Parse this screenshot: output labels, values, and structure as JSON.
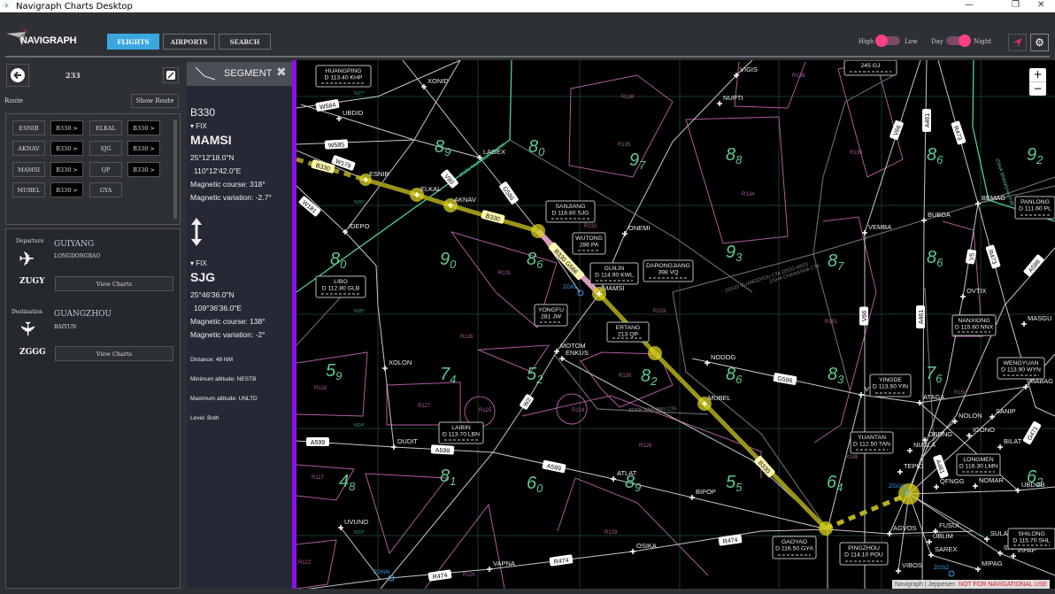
{
  "window": {
    "title": "Navigraph Charts Desktop",
    "controls": [
      "—",
      "❐",
      "✕"
    ]
  },
  "header": {
    "logo_text": "NAVIGRAPH",
    "tabs": [
      "FLIGHTS",
      "AIRPORTS",
      "SEARCH"
    ],
    "active_tab": "FLIGHTS",
    "detail_toggle": {
      "left": "High",
      "right": "Low",
      "value": "High"
    },
    "theme_toggle": {
      "left": "Day",
      "right": "Night",
      "value": "Night"
    },
    "accent": "#3aa7e0",
    "toggle_color": "#ff3f83"
  },
  "flight": {
    "id": "233",
    "route_label": "Route",
    "show_route": "Show Route",
    "route": [
      [
        "ESNIB",
        "B330 >",
        "ELKAL",
        "B330 >"
      ],
      [
        "AKNAV",
        "B330 >",
        "SJG",
        "B330 >"
      ],
      [
        "MAMSI",
        "B330 >",
        "QP",
        "B330 >"
      ],
      [
        "MUBEL",
        "B330 >",
        "GYA",
        ""
      ]
    ],
    "departure": {
      "label": "Departure",
      "city": "GUIYANG",
      "airport": "LONGDONGBAO",
      "icao": "ZUGY",
      "button": "View Charts"
    },
    "destination": {
      "label": "Destination",
      "city": "GUANGZHOU",
      "airport": "BAIYUN",
      "icao": "ZGGG",
      "button": "View Charts"
    }
  },
  "segment": {
    "title": "SEGMENT",
    "airway": "B330",
    "from": {
      "type": "FIX",
      "name": "MAMSI",
      "lat": "25°12'18.0\"N",
      "lon": "110°12'42.0\"E",
      "course": "Magnetic course: 318°",
      "variation": "Magnetic variation: -2.7°"
    },
    "to": {
      "type": "FIX",
      "name": "SJG",
      "lat": "25°46'36.0\"N",
      "lon": "109°36'36.0\"E",
      "course": "Magnetic course: 138°",
      "variation": "Magnetic variation: -2°"
    },
    "distance": "Distance: 48 NM",
    "min_alt": "Minimum altitude: NESTB",
    "max_alt": "Maximum altitude: UNLTD",
    "level": "Level: Both"
  },
  "map": {
    "zoom_in": "+",
    "zoom_out": "−",
    "attribution": {
      "navigraph": "Navigraph",
      "jeppesen": "Jeppesen",
      "warning": "NOT FOR NAVIGATIONAL USE"
    },
    "waypoints": [
      "ESNIB",
      "ELKAL",
      "AKNAV",
      "MAMSI",
      "MUBEL",
      "XONID",
      "UBDID",
      "LAGEX",
      "IDEPO",
      "NUPTI",
      "VIGIS",
      "ONEMI",
      "VEMBA",
      "BUBDA",
      "BEMAG",
      "MOTOM",
      "ENKUS",
      "XOLON",
      "NODOG",
      "VEROK",
      "ATAGA",
      "DUDIT",
      "ATLAT",
      "BIPOP",
      "UVUNO",
      "VAPNA",
      "OSIKA",
      "AGVOS",
      "OVTIX",
      "MASGU",
      "MABAG",
      "NOLON",
      "SANIP",
      "IGONO",
      "BILAT",
      "DBDNG",
      "NUSLA",
      "TEPID",
      "QFNGG",
      "NOMAR",
      "UBDOB",
      "SULAS",
      "UBLIM",
      "SAREX",
      "IDUMA",
      "VIPAP",
      "MIPAG",
      "VIBOS",
      "FUSUI"
    ],
    "navaids": [
      [
        "HUANGPING",
        "D 113.40 KHP"
      ],
      [
        "LIBO",
        "D 112.80 GLB"
      ],
      [
        "SANJIANG",
        "D 116.80 SJG"
      ],
      [
        "WUTONG",
        "286 PA"
      ],
      [
        "GUILIN",
        "D 114.90 KWL"
      ],
      [
        "DARONGJIANG",
        "398 VQ"
      ],
      [
        "YONGFU",
        "281 JW"
      ],
      [
        "ERTANG",
        "213 QP"
      ],
      [
        "LAIBIN",
        "D 113.70 LBN"
      ],
      [
        "YINGDE",
        "D 113.50 YIN"
      ],
      [
        "YUANTAN",
        "D 112.50 TAN"
      ],
      [
        "LONGMEN",
        "D 116.30 LMN"
      ],
      [
        "WENGYUAN",
        "D 113.90 WYN"
      ],
      [
        "GAOYAO",
        "D 116.50 GYA"
      ],
      [
        "PINGZHOU",
        "D 114.10 POU"
      ],
      [
        "SHILONG",
        "D 115.70 SHL"
      ],
      [
        "NANXIONG",
        "D 115.60 NNX"
      ],
      [
        "PANLONG",
        "D 111.60 PL"
      ],
      [
        "",
        "245 GJ"
      ]
    ],
    "airways": [
      "W584",
      "W585",
      "W179",
      "B330",
      "W181",
      "V80",
      "G586",
      "B330",
      "B330 G586",
      "A599",
      "A599",
      "A599",
      "R474",
      "R474",
      "R474",
      "W2",
      "B330",
      "G586",
      "V66",
      "A461",
      "R473",
      "V5",
      "R473",
      "A599",
      "V66",
      "A461",
      "G471",
      "A461"
    ],
    "mora": [
      [
        "8",
        "9"
      ],
      [
        "8",
        "0"
      ],
      [
        "9",
        "7"
      ],
      [
        "8",
        "0"
      ],
      [
        "9",
        "0"
      ],
      [
        "8",
        "6"
      ],
      [
        "8",
        "8"
      ],
      [
        "9",
        "3"
      ],
      [
        "8",
        "7"
      ],
      [
        "8",
        "6"
      ],
      [
        "8",
        "6"
      ],
      [
        "9",
        "2"
      ],
      [
        "5",
        "9"
      ],
      [
        "7",
        "4"
      ],
      [
        "5",
        "2"
      ],
      [
        "8",
        "2"
      ],
      [
        "8",
        "6"
      ],
      [
        "8",
        "3"
      ],
      [
        "7",
        "6"
      ],
      [
        "4",
        "8"
      ],
      [
        "8",
        "1"
      ],
      [
        "6",
        "0"
      ],
      [
        "8",
        "9"
      ],
      [
        "5",
        "5"
      ],
      [
        "6",
        "4"
      ],
      [
        "6",
        "2"
      ]
    ],
    "restricted": [
      "R131",
      "R132",
      "R133",
      "R134",
      "R135",
      "R136",
      "R138",
      "R139",
      "R126",
      "R130",
      "R124",
      "R125",
      "R127",
      "R118",
      "R117",
      "R128",
      "R129",
      "R122",
      "R120",
      "R151",
      "R148",
      "R150"
    ],
    "airports": [
      "ZGKL",
      "ZGGG",
      "ZGNN",
      "ZGSZ"
    ],
    "boundaries": [
      "ZGZU GUANGZHOU FIR",
      "ZGGG GUANGZHOU CTA ZGGG AR23",
      "ZGHA CHANGSHA CTA",
      "ZGNN NANNING CTA",
      "ZSHA SHANGHAI FIR"
    ],
    "grid": [
      "N27°",
      "N26°",
      "N25°",
      "N24°",
      "N23°"
    ]
  }
}
